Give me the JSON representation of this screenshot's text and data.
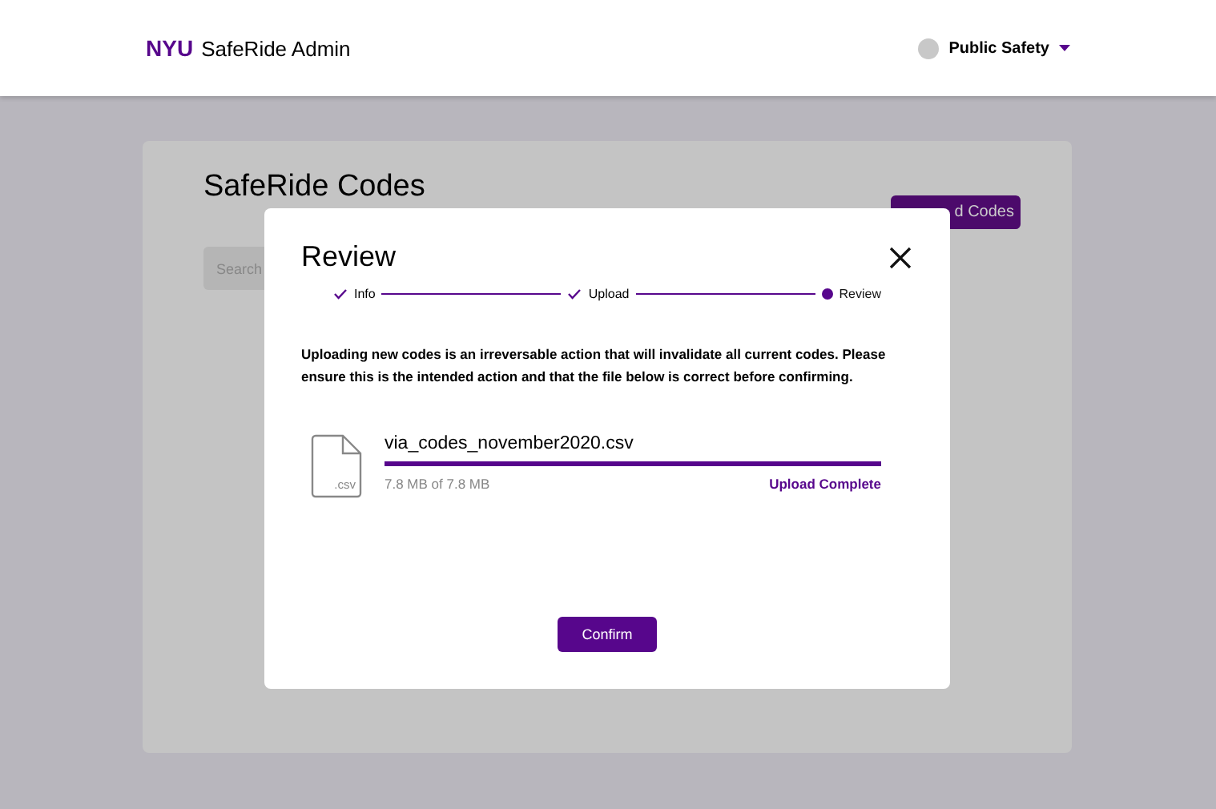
{
  "header": {
    "brand": "NYU",
    "title": "SafeRide Admin",
    "account": "Public Safety"
  },
  "page": {
    "title": "SafeRide Codes",
    "button": "d Codes",
    "search": {
      "placeholder": "Search"
    }
  },
  "modal": {
    "title": "Review",
    "steps": [
      {
        "label": "Info",
        "done": true,
        "selected": false
      },
      {
        "label": "Upload",
        "done": true,
        "selected": false
      },
      {
        "label": "Review",
        "done": false,
        "selected": true
      }
    ],
    "message": "Uploading new codes is an irreversable action that will invalidate all current codes. Please ensure this is the intended action and that the file below is correct before confirming.",
    "file": {
      "extension": ".csv",
      "name": "via_codes_november2020.csv",
      "level": 1,
      "size": "7.8 MB of 7.8 MB",
      "status": "Upload Complete"
    },
    "confirm": "Confirm"
  }
}
